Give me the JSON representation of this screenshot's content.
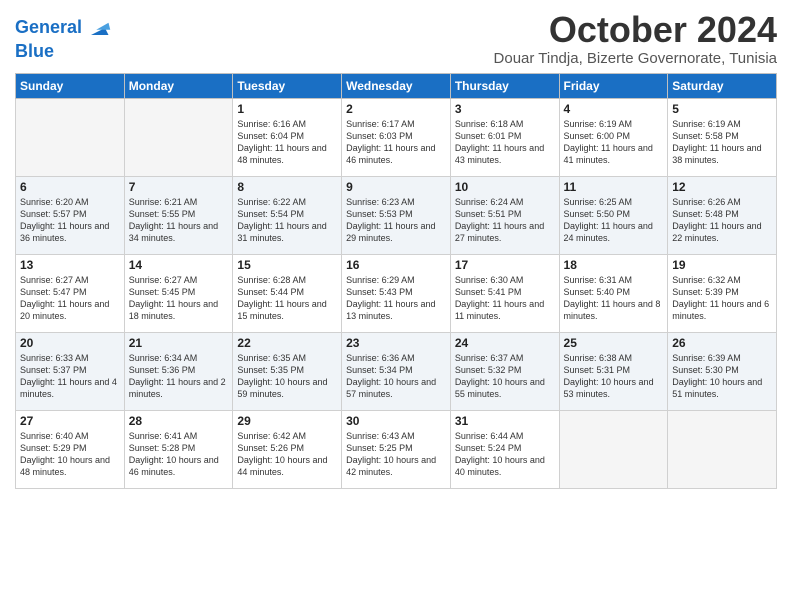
{
  "logo": {
    "line1": "General",
    "line2": "Blue"
  },
  "title": "October 2024",
  "subtitle": "Douar Tindja, Bizerte Governorate, Tunisia",
  "weekdays": [
    "Sunday",
    "Monday",
    "Tuesday",
    "Wednesday",
    "Thursday",
    "Friday",
    "Saturday"
  ],
  "weeks": [
    [
      {
        "day": "",
        "sunrise": "",
        "sunset": "",
        "daylight": ""
      },
      {
        "day": "",
        "sunrise": "",
        "sunset": "",
        "daylight": ""
      },
      {
        "day": "1",
        "sunrise": "Sunrise: 6:16 AM",
        "sunset": "Sunset: 6:04 PM",
        "daylight": "Daylight: 11 hours and 48 minutes."
      },
      {
        "day": "2",
        "sunrise": "Sunrise: 6:17 AM",
        "sunset": "Sunset: 6:03 PM",
        "daylight": "Daylight: 11 hours and 46 minutes."
      },
      {
        "day": "3",
        "sunrise": "Sunrise: 6:18 AM",
        "sunset": "Sunset: 6:01 PM",
        "daylight": "Daylight: 11 hours and 43 minutes."
      },
      {
        "day": "4",
        "sunrise": "Sunrise: 6:19 AM",
        "sunset": "Sunset: 6:00 PM",
        "daylight": "Daylight: 11 hours and 41 minutes."
      },
      {
        "day": "5",
        "sunrise": "Sunrise: 6:19 AM",
        "sunset": "Sunset: 5:58 PM",
        "daylight": "Daylight: 11 hours and 38 minutes."
      }
    ],
    [
      {
        "day": "6",
        "sunrise": "Sunrise: 6:20 AM",
        "sunset": "Sunset: 5:57 PM",
        "daylight": "Daylight: 11 hours and 36 minutes."
      },
      {
        "day": "7",
        "sunrise": "Sunrise: 6:21 AM",
        "sunset": "Sunset: 5:55 PM",
        "daylight": "Daylight: 11 hours and 34 minutes."
      },
      {
        "day": "8",
        "sunrise": "Sunrise: 6:22 AM",
        "sunset": "Sunset: 5:54 PM",
        "daylight": "Daylight: 11 hours and 31 minutes."
      },
      {
        "day": "9",
        "sunrise": "Sunrise: 6:23 AM",
        "sunset": "Sunset: 5:53 PM",
        "daylight": "Daylight: 11 hours and 29 minutes."
      },
      {
        "day": "10",
        "sunrise": "Sunrise: 6:24 AM",
        "sunset": "Sunset: 5:51 PM",
        "daylight": "Daylight: 11 hours and 27 minutes."
      },
      {
        "day": "11",
        "sunrise": "Sunrise: 6:25 AM",
        "sunset": "Sunset: 5:50 PM",
        "daylight": "Daylight: 11 hours and 24 minutes."
      },
      {
        "day": "12",
        "sunrise": "Sunrise: 6:26 AM",
        "sunset": "Sunset: 5:48 PM",
        "daylight": "Daylight: 11 hours and 22 minutes."
      }
    ],
    [
      {
        "day": "13",
        "sunrise": "Sunrise: 6:27 AM",
        "sunset": "Sunset: 5:47 PM",
        "daylight": "Daylight: 11 hours and 20 minutes."
      },
      {
        "day": "14",
        "sunrise": "Sunrise: 6:27 AM",
        "sunset": "Sunset: 5:45 PM",
        "daylight": "Daylight: 11 hours and 18 minutes."
      },
      {
        "day": "15",
        "sunrise": "Sunrise: 6:28 AM",
        "sunset": "Sunset: 5:44 PM",
        "daylight": "Daylight: 11 hours and 15 minutes."
      },
      {
        "day": "16",
        "sunrise": "Sunrise: 6:29 AM",
        "sunset": "Sunset: 5:43 PM",
        "daylight": "Daylight: 11 hours and 13 minutes."
      },
      {
        "day": "17",
        "sunrise": "Sunrise: 6:30 AM",
        "sunset": "Sunset: 5:41 PM",
        "daylight": "Daylight: 11 hours and 11 minutes."
      },
      {
        "day": "18",
        "sunrise": "Sunrise: 6:31 AM",
        "sunset": "Sunset: 5:40 PM",
        "daylight": "Daylight: 11 hours and 8 minutes."
      },
      {
        "day": "19",
        "sunrise": "Sunrise: 6:32 AM",
        "sunset": "Sunset: 5:39 PM",
        "daylight": "Daylight: 11 hours and 6 minutes."
      }
    ],
    [
      {
        "day": "20",
        "sunrise": "Sunrise: 6:33 AM",
        "sunset": "Sunset: 5:37 PM",
        "daylight": "Daylight: 11 hours and 4 minutes."
      },
      {
        "day": "21",
        "sunrise": "Sunrise: 6:34 AM",
        "sunset": "Sunset: 5:36 PM",
        "daylight": "Daylight: 11 hours and 2 minutes."
      },
      {
        "day": "22",
        "sunrise": "Sunrise: 6:35 AM",
        "sunset": "Sunset: 5:35 PM",
        "daylight": "Daylight: 10 hours and 59 minutes."
      },
      {
        "day": "23",
        "sunrise": "Sunrise: 6:36 AM",
        "sunset": "Sunset: 5:34 PM",
        "daylight": "Daylight: 10 hours and 57 minutes."
      },
      {
        "day": "24",
        "sunrise": "Sunrise: 6:37 AM",
        "sunset": "Sunset: 5:32 PM",
        "daylight": "Daylight: 10 hours and 55 minutes."
      },
      {
        "day": "25",
        "sunrise": "Sunrise: 6:38 AM",
        "sunset": "Sunset: 5:31 PM",
        "daylight": "Daylight: 10 hours and 53 minutes."
      },
      {
        "day": "26",
        "sunrise": "Sunrise: 6:39 AM",
        "sunset": "Sunset: 5:30 PM",
        "daylight": "Daylight: 10 hours and 51 minutes."
      }
    ],
    [
      {
        "day": "27",
        "sunrise": "Sunrise: 6:40 AM",
        "sunset": "Sunset: 5:29 PM",
        "daylight": "Daylight: 10 hours and 48 minutes."
      },
      {
        "day": "28",
        "sunrise": "Sunrise: 6:41 AM",
        "sunset": "Sunset: 5:28 PM",
        "daylight": "Daylight: 10 hours and 46 minutes."
      },
      {
        "day": "29",
        "sunrise": "Sunrise: 6:42 AM",
        "sunset": "Sunset: 5:26 PM",
        "daylight": "Daylight: 10 hours and 44 minutes."
      },
      {
        "day": "30",
        "sunrise": "Sunrise: 6:43 AM",
        "sunset": "Sunset: 5:25 PM",
        "daylight": "Daylight: 10 hours and 42 minutes."
      },
      {
        "day": "31",
        "sunrise": "Sunrise: 6:44 AM",
        "sunset": "Sunset: 5:24 PM",
        "daylight": "Daylight: 10 hours and 40 minutes."
      },
      {
        "day": "",
        "sunrise": "",
        "sunset": "",
        "daylight": ""
      },
      {
        "day": "",
        "sunrise": "",
        "sunset": "",
        "daylight": ""
      }
    ]
  ]
}
